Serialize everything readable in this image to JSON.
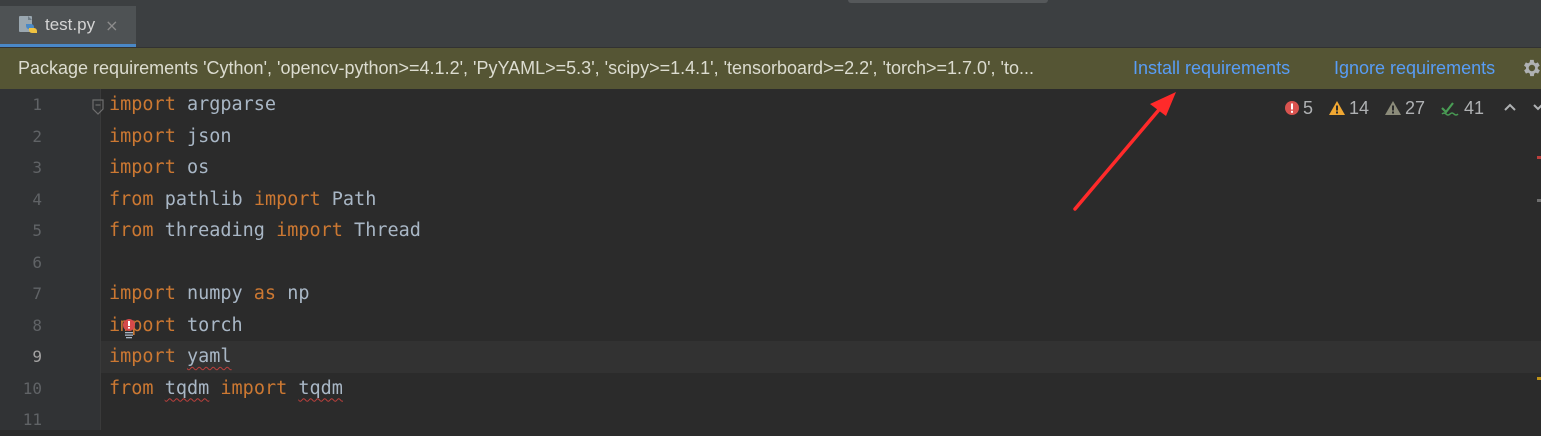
{
  "tab": {
    "filename": "test.py",
    "close_glyph": "×",
    "icon": "python-file-icon"
  },
  "banner": {
    "message": "Package requirements 'Cython', 'opencv-python>=4.1.2', 'PyYAML>=5.3', 'scipy>=1.4.1', 'tensorboard>=2.2', 'torch>=1.7.0', 'to...",
    "install_label": "Install requirements",
    "ignore_label": "Ignore requirements",
    "background_color": "#555534",
    "link_color": "#589df6"
  },
  "inspections": {
    "errors": "5",
    "warnings": "14",
    "weak_warnings": "27",
    "typos": "41"
  },
  "editor": {
    "lines": [
      {
        "num": "1",
        "tokens": [
          {
            "t": "import",
            "k": "kw"
          },
          {
            "t": " argparse",
            "k": ""
          }
        ]
      },
      {
        "num": "2",
        "tokens": [
          {
            "t": "import",
            "k": "kw"
          },
          {
            "t": " json",
            "k": ""
          }
        ]
      },
      {
        "num": "3",
        "tokens": [
          {
            "t": "import",
            "k": "kw"
          },
          {
            "t": " os",
            "k": ""
          }
        ]
      },
      {
        "num": "4",
        "tokens": [
          {
            "t": "from",
            "k": "kw"
          },
          {
            "t": " pathlib ",
            "k": ""
          },
          {
            "t": "import",
            "k": "kw"
          },
          {
            "t": " Path",
            "k": ""
          }
        ]
      },
      {
        "num": "5",
        "tokens": [
          {
            "t": "from",
            "k": "kw"
          },
          {
            "t": " threading ",
            "k": ""
          },
          {
            "t": "import",
            "k": "kw"
          },
          {
            "t": " Thread",
            "k": ""
          }
        ]
      },
      {
        "num": "6",
        "tokens": []
      },
      {
        "num": "7",
        "tokens": [
          {
            "t": "import",
            "k": "kw"
          },
          {
            "t": " numpy ",
            "k": ""
          },
          {
            "t": "as",
            "k": "kw"
          },
          {
            "t": " np",
            "k": ""
          }
        ]
      },
      {
        "num": "8",
        "tokens": [
          {
            "t": "import",
            "k": "kw"
          },
          {
            "t": " torch",
            "k": ""
          }
        ]
      },
      {
        "num": "9",
        "tokens": [
          {
            "t": "import",
            "k": "kw"
          },
          {
            "t": " ",
            "k": ""
          },
          {
            "t": "yaml",
            "k": "squig"
          }
        ]
      },
      {
        "num": "10",
        "tokens": [
          {
            "t": "from",
            "k": "kw"
          },
          {
            "t": " ",
            "k": ""
          },
          {
            "t": "tqdm",
            "k": "squig"
          },
          {
            "t": " ",
            "k": ""
          },
          {
            "t": "import",
            "k": "kw"
          },
          {
            "t": " ",
            "k": ""
          },
          {
            "t": "tqdm",
            "k": "squig"
          }
        ]
      },
      {
        "num": "11",
        "tokens": []
      }
    ],
    "current_line": "9",
    "keyword_color": "#cc7832",
    "text_color": "#a9b7c6"
  }
}
